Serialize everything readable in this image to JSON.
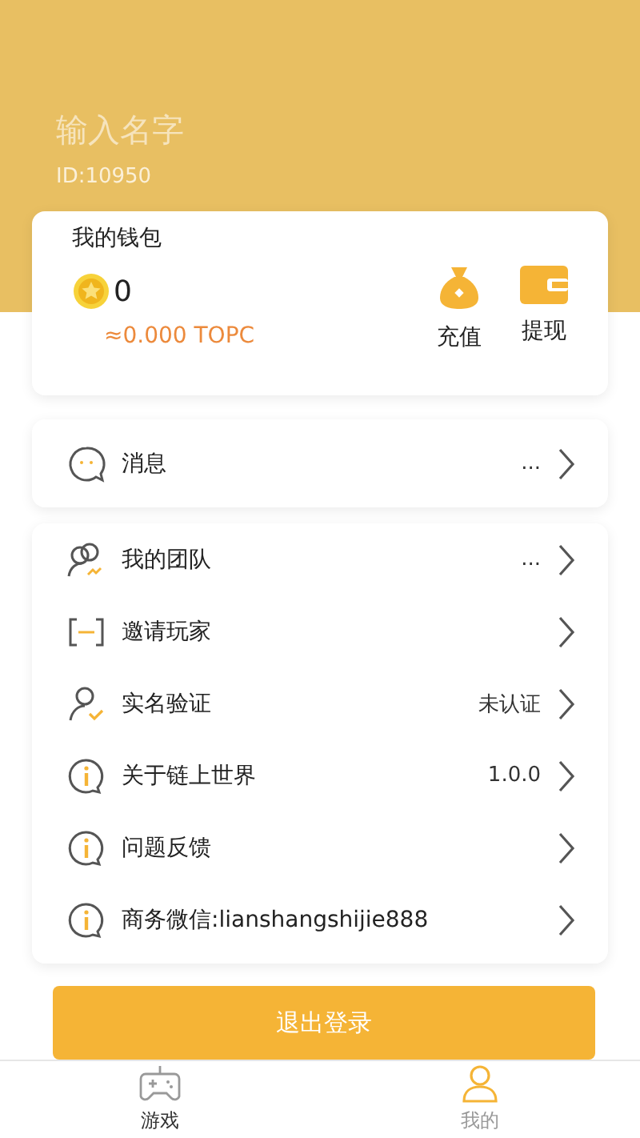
{
  "profile": {
    "name": "输入名字",
    "id": "ID:10950"
  },
  "wallet": {
    "title": "我的钱包",
    "balance": "0",
    "conversion": "≈0.000 TOPC",
    "actions": [
      {
        "kind": "recharge",
        "label": "充值"
      },
      {
        "kind": "withdraw",
        "label": "提现"
      }
    ]
  },
  "message_item": {
    "kind": "chat",
    "label": "消息",
    "value": "..."
  },
  "menu_items": [
    {
      "kind": "team",
      "label": "我的团队",
      "value": "..."
    },
    {
      "kind": "invite",
      "label": "邀请玩家"
    },
    {
      "kind": "verify",
      "label": "实名验证",
      "value": "未认证"
    },
    {
      "kind": "info",
      "label": "关于链上世界",
      "value": "1.0.0"
    },
    {
      "kind": "info",
      "label": "问题反馈"
    },
    {
      "kind": "info",
      "label": "商务微信:lianshangshijie888"
    }
  ],
  "logout_button": "退出登录",
  "tabs": [
    {
      "kind": "game",
      "label": "游戏",
      "selected": false
    },
    {
      "kind": "profile",
      "label": "我的",
      "selected": true
    }
  ]
}
